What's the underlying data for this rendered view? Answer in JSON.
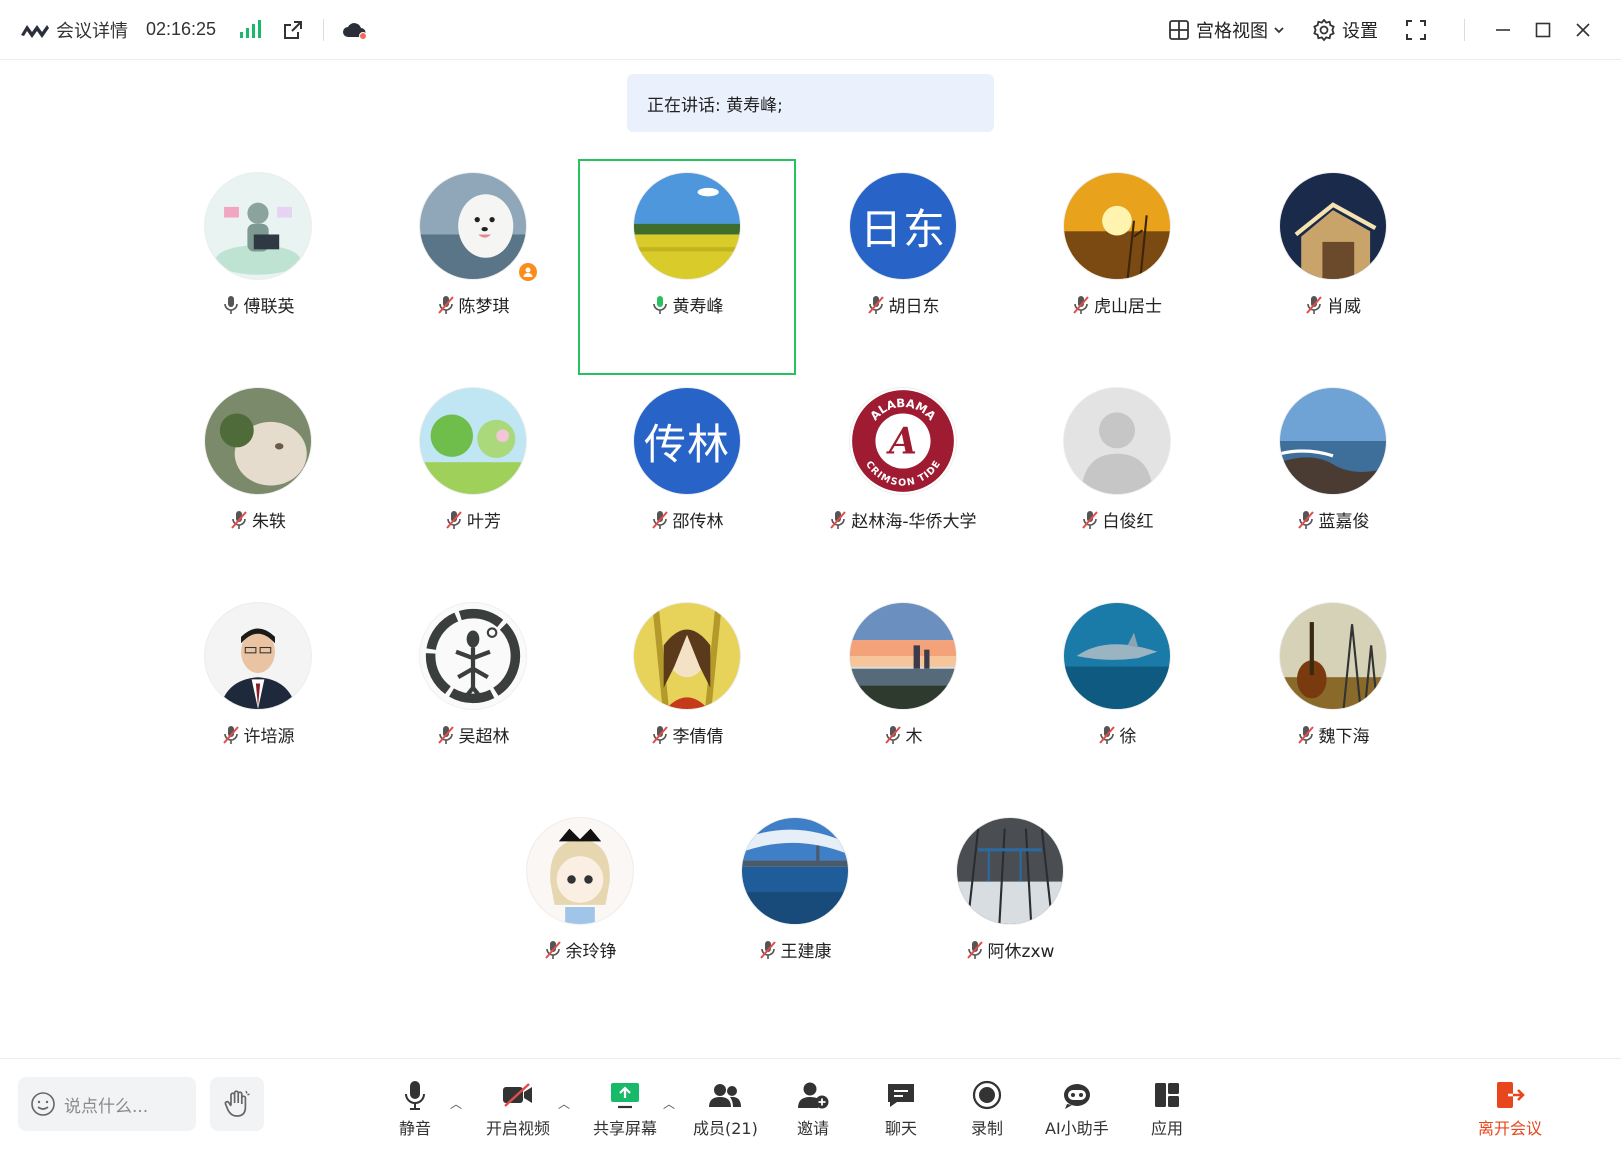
{
  "titlebar": {
    "meeting_info": "会议详情",
    "clock": "02:16:25",
    "gallery_view": "宫格视图",
    "settings": "设置"
  },
  "speaking": {
    "text": "正在讲话: 黄寿峰;"
  },
  "participants": [
    {
      "name": "傅联英",
      "mic": "on"
    },
    {
      "name": "陈梦琪",
      "mic": "muted",
      "host": true
    },
    {
      "name": "黄寿峰",
      "mic": "speaking",
      "active": true
    },
    {
      "name": "胡日东",
      "mic": "muted",
      "avatar_text": "日东"
    },
    {
      "name": "虎山居士",
      "mic": "muted"
    },
    {
      "name": "肖威",
      "mic": "muted"
    },
    {
      "name": "朱轶",
      "mic": "muted"
    },
    {
      "name": "叶芳",
      "mic": "muted"
    },
    {
      "name": "邵传林",
      "mic": "muted",
      "avatar_text": "传林"
    },
    {
      "name": "赵林海-华侨大学",
      "mic": "muted"
    },
    {
      "name": "白俊红",
      "mic": "muted"
    },
    {
      "name": "蓝嘉俊",
      "mic": "muted"
    },
    {
      "name": "许培源",
      "mic": "muted"
    },
    {
      "name": "吴超林",
      "mic": "muted"
    },
    {
      "name": "李倩倩",
      "mic": "muted"
    },
    {
      "name": "木",
      "mic": "muted"
    },
    {
      "name": "徐",
      "mic": "muted"
    },
    {
      "name": "魏下海",
      "mic": "muted"
    },
    {
      "name": "余玲铮",
      "mic": "muted"
    },
    {
      "name": "王建康",
      "mic": "muted"
    },
    {
      "name": "阿休zxw",
      "mic": "muted"
    }
  ],
  "alabama_badge": {
    "top": "ALABAMA",
    "bottom": "CRIMSON TIDE",
    "letter": "A"
  },
  "toolbar": {
    "chat_placeholder": "说点什么...",
    "mute": "静音",
    "start_video": "开启视频",
    "share_screen": "共享屏幕",
    "members": "成员(21)",
    "invite": "邀请",
    "chat": "聊天",
    "record": "录制",
    "ai_assistant": "AI小助手",
    "apps": "应用",
    "leave": "离开会议"
  },
  "colors": {
    "speaking_bg": "#eaf1fd",
    "active_border": "#27c25f",
    "leave_red": "#e8471d",
    "avatar_blue": "#2864c8",
    "muted_red": "#e34c4c",
    "signal_green": "#19b96a"
  }
}
